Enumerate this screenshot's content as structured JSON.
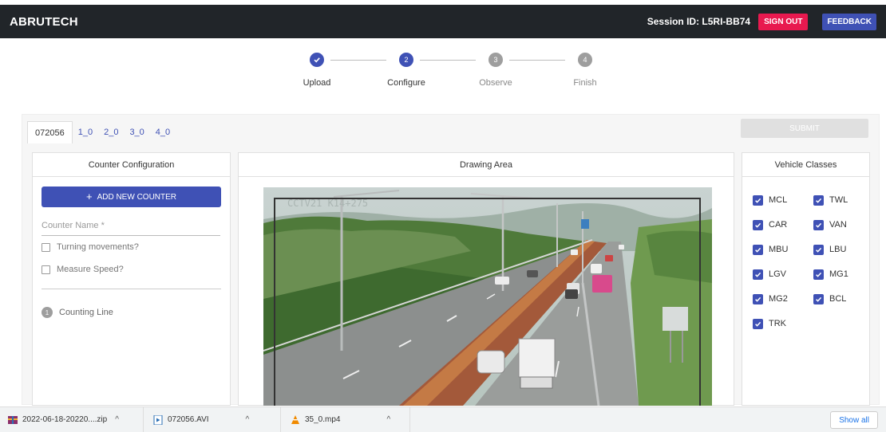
{
  "appbar": {
    "brand": "ABRUTECH",
    "session": "Session ID: L5RI-BB74",
    "sign_out": "SIGN OUT",
    "feedback": "FEEDBACK",
    "bg_color": "#212529",
    "sign_out_color": "#e8194f",
    "feedback_color": "#3f51b5"
  },
  "stepper": {
    "steps": [
      {
        "label": "Upload",
        "state": "completed",
        "number": ""
      },
      {
        "label": "Configure",
        "state": "active",
        "number": "2"
      },
      {
        "label": "Observe",
        "state": "inactive",
        "number": "3"
      },
      {
        "label": "Finish",
        "state": "inactive",
        "number": "4"
      }
    ]
  },
  "tabs": [
    {
      "label": "072056",
      "active": true
    },
    {
      "label": "1_0",
      "active": false
    },
    {
      "label": "2_0",
      "active": false
    },
    {
      "label": "3_0",
      "active": false
    },
    {
      "label": "4_0",
      "active": false
    }
  ],
  "submit_label": "SUBMIT",
  "counter_config": {
    "title": "Counter Configuration",
    "add_button": "ADD NEW COUNTER",
    "name_placeholder": "Counter Name *",
    "turning_movements": "Turning movements?",
    "measure_speed": "Measure Speed?",
    "counting_line_number": "1",
    "counting_line": "Counting Line"
  },
  "drawing_area": {
    "title": "Drawing Area",
    "camera_overlay": "CCTV21 K14+275"
  },
  "vehicle_classes": {
    "title": "Vehicle Classes",
    "items": [
      {
        "label": "MCL",
        "checked": true
      },
      {
        "label": "TWL",
        "checked": true
      },
      {
        "label": "CAR",
        "checked": true
      },
      {
        "label": "VAN",
        "checked": true
      },
      {
        "label": "MBU",
        "checked": true
      },
      {
        "label": "LBU",
        "checked": true
      },
      {
        "label": "LGV",
        "checked": true
      },
      {
        "label": "MG1",
        "checked": true
      },
      {
        "label": "MG2",
        "checked": true
      },
      {
        "label": "BCL",
        "checked": true
      },
      {
        "label": "TRK",
        "checked": true
      }
    ]
  },
  "downloads": {
    "items": [
      {
        "name": "2022-06-18-20220....zip",
        "icon": "archive-icon"
      },
      {
        "name": "072056.AVI",
        "icon": "video-file-icon"
      },
      {
        "name": "35_0.mp4",
        "icon": "vlc-icon"
      }
    ],
    "show_all": "Show all"
  },
  "accent_color": "#3f51b5"
}
